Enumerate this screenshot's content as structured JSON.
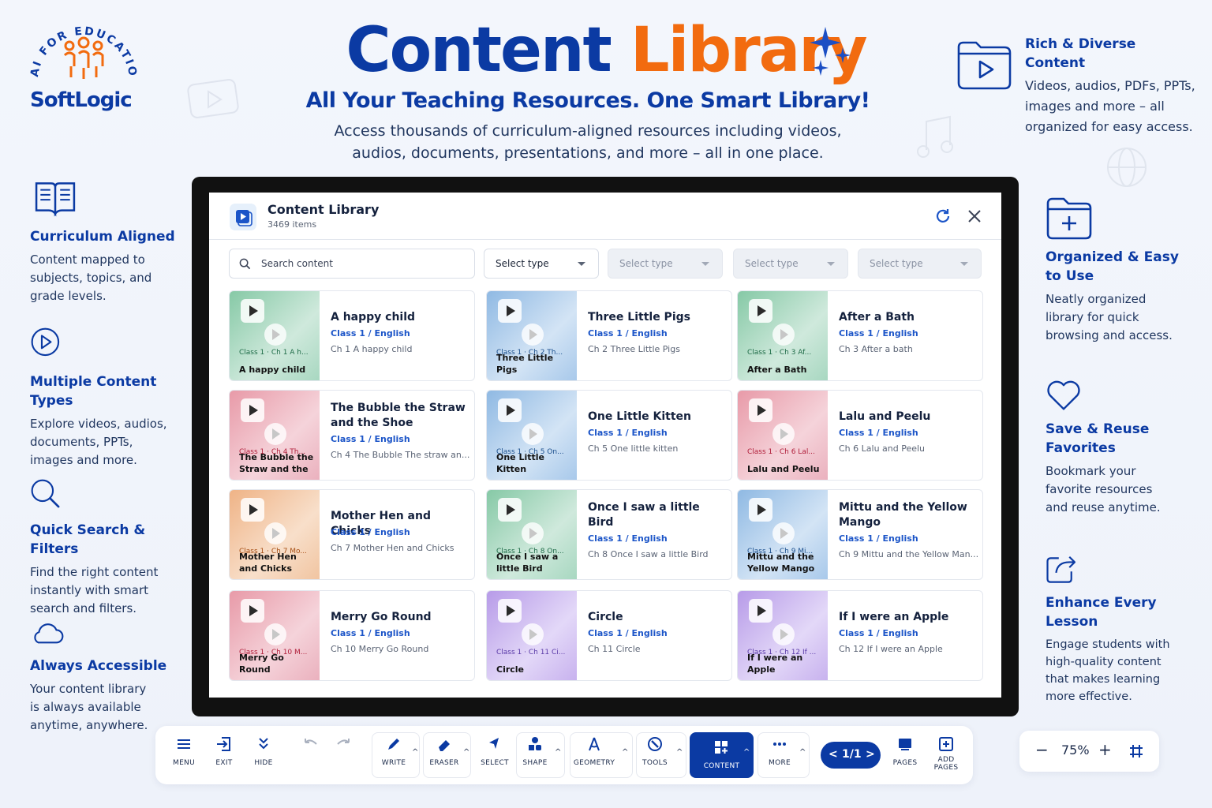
{
  "logo": {
    "arc_text": "AI FOR EDUCATION",
    "name": "SoftLogic"
  },
  "hero": {
    "title_a": "Content",
    "title_b": "Library",
    "subtitle": "All Your Teaching Resources. One Smart Library!",
    "desc_line1": "Access thousands of curriculum-aligned resources including videos,",
    "desc_line2": "audios, documents, presentations, and more – all in one place."
  },
  "features_left": [
    {
      "title": "Curriculum Aligned",
      "text": [
        "Content mapped to",
        "subjects, topics, and",
        "grade levels."
      ],
      "icon": "book-icon"
    },
    {
      "title": "Multiple Content Types",
      "text": [
        "Explore videos, audios,",
        "documents, PPTs,",
        "images and more."
      ],
      "icon": "play-circle-icon"
    },
    {
      "title": "Quick Search & Filters",
      "text": [
        "Find the right content",
        "instantly with smart",
        "search and filters."
      ],
      "icon": "search-icon"
    },
    {
      "title": "Always Accessible",
      "text": [
        "Your content library",
        "is always available",
        "anytime, anywhere."
      ],
      "icon": "cloud-icon"
    }
  ],
  "features_right": [
    {
      "title": [
        "Rich & Diverse Content"
      ],
      "text": [
        "Videos, audios, PDFs, PPTs,",
        "images and more – all",
        "organized for easy access."
      ],
      "icon": "folder-play-icon"
    },
    {
      "title": [
        "Organized & Easy",
        "to Use"
      ],
      "text": [
        "Neatly organized",
        "library for quick",
        "browsing and access."
      ],
      "icon": "folder-plus-icon"
    },
    {
      "title": [
        "Save & Reuse",
        "Favorites"
      ],
      "text": [
        "Bookmark your",
        "favorite resources",
        "and reuse anytime."
      ],
      "icon": "heart-icon"
    },
    {
      "title": [
        "Enhance Every Lesson"
      ],
      "text": [
        "Engage students with",
        "high-quality content",
        "that makes learning",
        "more effective."
      ],
      "icon": "share-icon"
    }
  ],
  "panel": {
    "title": "Content Library",
    "count": "3469 items",
    "search_placeholder": "Search content",
    "filters": [
      "Select type",
      "Select type",
      "Select type",
      "Select type"
    ]
  },
  "cards": [
    {
      "title": "A happy child",
      "class": "Class 1 / English",
      "sub": "Ch 1 A happy child",
      "cap1": "Class 1 · Ch 1 A h...",
      "cap2": "A happy child",
      "theme": "green"
    },
    {
      "title": "Three Little Pigs",
      "class": "Class 1 / English",
      "sub": "Ch 2 Three Little Pigs",
      "cap1": "Class 1 · Ch 2 Th...",
      "cap2": "Three Little Pigs",
      "theme": "blue"
    },
    {
      "title": "After a Bath",
      "class": "Class 1 / English",
      "sub": "Ch 3 After a bath",
      "cap1": "Class 1 · Ch 3 Af...",
      "cap2": "After a Bath",
      "theme": "green"
    },
    {
      "title": "The Bubble the Straw and the Shoe",
      "class": "Class 1 / English",
      "sub": "Ch 4 The Bubble The straw an...",
      "cap1": "Class 1 · Ch 4 Th...",
      "cap2": "The Bubble the Straw and the ...",
      "theme": "pink"
    },
    {
      "title": "One Little Kitten",
      "class": "Class 1 / English",
      "sub": "Ch 5 One little kitten",
      "cap1": "Class 1 · Ch 5 On...",
      "cap2": "One Little Kitten",
      "theme": "blue"
    },
    {
      "title": "Lalu and Peelu",
      "class": "Class 1 / English",
      "sub": "Ch 6 Lalu and Peelu",
      "cap1": "Class 1 · Ch 6 Lal...",
      "cap2": "Lalu and Peelu",
      "theme": "pink"
    },
    {
      "title": "Mother Hen and Chicks",
      "class": "Class 1 / English",
      "sub": "Ch 7 Mother Hen and Chicks",
      "cap1": "Class 1 · Ch 7 Mo...",
      "cap2": "Mother Hen and Chicks",
      "theme": "orange"
    },
    {
      "title": "Once I saw a little Bird",
      "class": "Class 1 / English",
      "sub": "Ch 8 Once I saw a little Bird",
      "cap1": "Class 1 · Ch 8 On...",
      "cap2": "Once I saw a little Bird",
      "theme": "green"
    },
    {
      "title": "Mittu and the Yellow Mango",
      "class": "Class 1 / English",
      "sub": "Ch 9 Mittu and the Yellow Man...",
      "cap1": "Class 1 · Ch 9 Mi...",
      "cap2": "Mittu and the Yellow Mango",
      "theme": "blue"
    },
    {
      "title": "Merry Go Round",
      "class": "Class 1 / English",
      "sub": "Ch 10 Merry Go Round",
      "cap1": "Class 1 · Ch 10 M...",
      "cap2": "Merry Go Round",
      "theme": "pink"
    },
    {
      "title": "Circle",
      "class": "Class 1 / English",
      "sub": "Ch 11 Circle",
      "cap1": "Class 1 · Ch 11 Ci...",
      "cap2": "Circle",
      "theme": "purple"
    },
    {
      "title": "If I were an Apple",
      "class": "Class 1 / English",
      "sub": "Ch 12 If I were an Apple",
      "cap1": "Class 1 · Ch 12 If ...",
      "cap2": "If I were an Apple",
      "theme": "purple"
    }
  ],
  "toolbar": {
    "menu": "MENU",
    "exit": "EXIT",
    "hide": "HIDE",
    "write": "WRITE",
    "eraser": "ERASER",
    "select": "SELECT",
    "shape": "SHAPE",
    "geometry": "GEOMETRY",
    "tools": "TOOLS",
    "content": "CONTENT",
    "more": "MORE",
    "pager": "1/1",
    "pages": "PAGES",
    "add_pages_1": "ADD",
    "add_pages_2": "PAGES"
  },
  "zoom": {
    "level": "75%"
  },
  "colors": {
    "primary": "#0b3aa3",
    "accent": "#f26b0f",
    "class_link": "#1c55c8"
  }
}
